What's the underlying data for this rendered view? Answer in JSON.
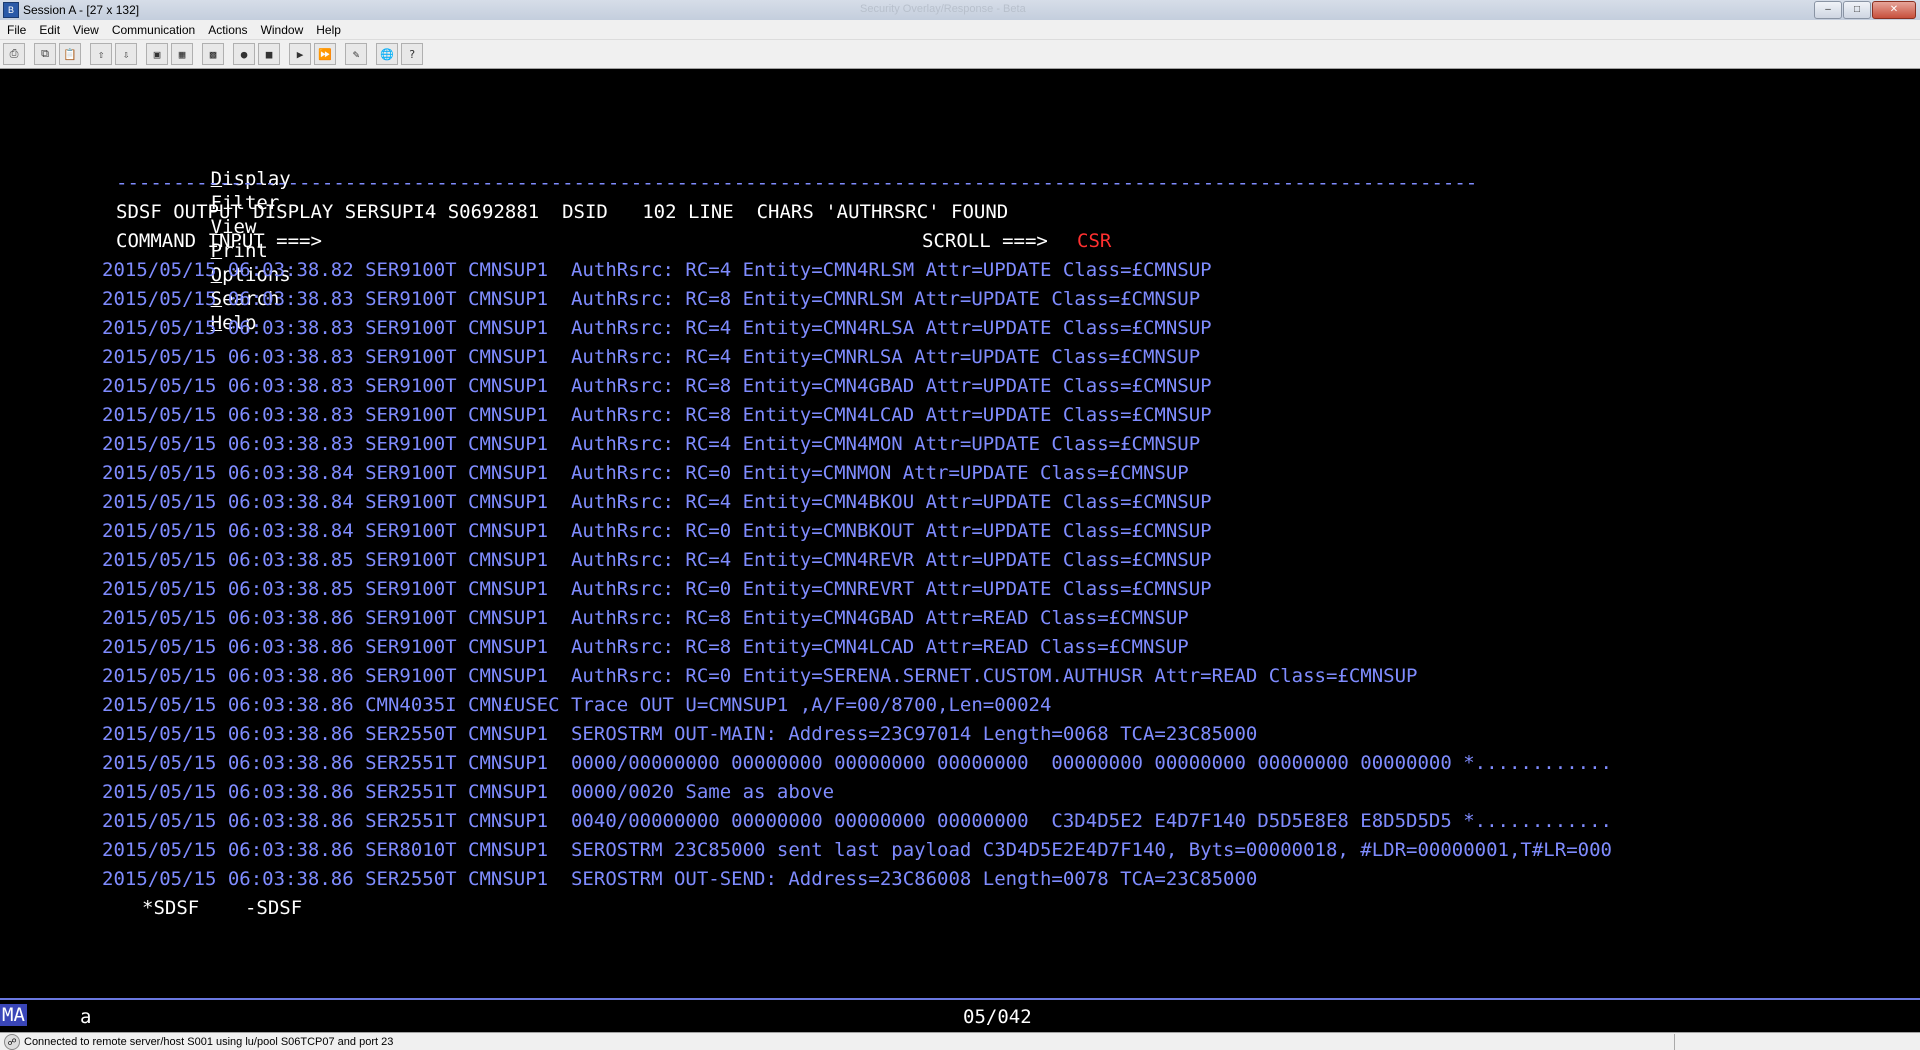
{
  "window": {
    "title": "Session A - [27 x 132]",
    "faded_title": "Security Overlay/Response - Beta",
    "minimize": "–",
    "maximize": "□",
    "close": "✕"
  },
  "menubar": {
    "items": [
      "File",
      "Edit",
      "View",
      "Communication",
      "Actions",
      "Window",
      "Help"
    ]
  },
  "toolbar": {
    "icons": [
      "print-screen-icon",
      "copy-icon",
      "paste-icon",
      "send-file-icon",
      "receive-file-icon",
      "display-icon",
      "keypad-icon",
      "color-map-icon",
      "macro-record-icon",
      "macro-stop-icon",
      "macro-play-icon",
      "macro-play-2-icon",
      "customize-icon",
      "globe-icon",
      "help-icon"
    ]
  },
  "terminal": {
    "action_bar": {
      "items": [
        {
          "acc": "D",
          "rest": "isplay"
        },
        {
          "acc": "F",
          "rest": "ilter"
        },
        {
          "acc": "V",
          "rest": "iew"
        },
        {
          "acc": "P",
          "rest": "rint"
        },
        {
          "acc": "O",
          "rest": "ptions"
        },
        {
          "acc": "S",
          "rest": "earch"
        },
        {
          "acc": "H",
          "rest": "elp"
        }
      ]
    },
    "separator": "-----------------------------------------------------------------------------------------------------------------------",
    "header_line": "SDSF OUTPUT DISPLAY SERSUPI4 S0692881  DSID   102 LINE  CHARS 'AUTHRSRC' FOUND",
    "command_label": "COMMAND INPUT ===>",
    "command_value": "",
    "scroll_label": "SCROLL ===>",
    "scroll_value": "CSR",
    "lines": [
      "2015/05/15 06:03:38.82 SER9100T CMNSUP1  AuthRsrc: RC=4 Entity=CMN4RLSM Attr=UPDATE Class=£CMNSUP",
      "2015/05/15 06:03:38.83 SER9100T CMNSUP1  AuthRsrc: RC=8 Entity=CMNRLSM Attr=UPDATE Class=£CMNSUP",
      "2015/05/15 06:03:38.83 SER9100T CMNSUP1  AuthRsrc: RC=4 Entity=CMN4RLSA Attr=UPDATE Class=£CMNSUP",
      "2015/05/15 06:03:38.83 SER9100T CMNSUP1  AuthRsrc: RC=4 Entity=CMNRLSA Attr=UPDATE Class=£CMNSUP",
      "2015/05/15 06:03:38.83 SER9100T CMNSUP1  AuthRsrc: RC=8 Entity=CMN4GBAD Attr=UPDATE Class=£CMNSUP",
      "2015/05/15 06:03:38.83 SER9100T CMNSUP1  AuthRsrc: RC=8 Entity=CMN4LCAD Attr=UPDATE Class=£CMNSUP",
      "2015/05/15 06:03:38.83 SER9100T CMNSUP1  AuthRsrc: RC=4 Entity=CMN4MON Attr=UPDATE Class=£CMNSUP",
      "2015/05/15 06:03:38.84 SER9100T CMNSUP1  AuthRsrc: RC=0 Entity=CMNMON Attr=UPDATE Class=£CMNSUP",
      "2015/05/15 06:03:38.84 SER9100T CMNSUP1  AuthRsrc: RC=4 Entity=CMN4BKOU Attr=UPDATE Class=£CMNSUP",
      "2015/05/15 06:03:38.84 SER9100T CMNSUP1  AuthRsrc: RC=0 Entity=CMNBKOUT Attr=UPDATE Class=£CMNSUP",
      "2015/05/15 06:03:38.85 SER9100T CMNSUP1  AuthRsrc: RC=4 Entity=CMN4REVR Attr=UPDATE Class=£CMNSUP",
      "2015/05/15 06:03:38.85 SER9100T CMNSUP1  AuthRsrc: RC=0 Entity=CMNREVRT Attr=UPDATE Class=£CMNSUP",
      "2015/05/15 06:03:38.86 SER9100T CMNSUP1  AuthRsrc: RC=8 Entity=CMN4GBAD Attr=READ Class=£CMNSUP",
      "2015/05/15 06:03:38.86 SER9100T CMNSUP1  AuthRsrc: RC=8 Entity=CMN4LCAD Attr=READ Class=£CMNSUP",
      "2015/05/15 06:03:38.86 SER9100T CMNSUP1  AuthRsrc: RC=0 Entity=SERENA.SERNET.CUSTOM.AUTHUSR Attr=READ Class=£CMNSUP",
      "2015/05/15 06:03:38.86 CMN4035I CMN£USEC Trace OUT U=CMNSUP1 ,A/F=00/8700,Len=00024",
      "2015/05/15 06:03:38.86 SER2550T CMNSUP1  SEROSTRM OUT-MAIN: Address=23C97014 Length=0068 TCA=23C85000",
      "2015/05/15 06:03:38.86 SER2551T CMNSUP1  0000/00000000 00000000 00000000 00000000  00000000 00000000 00000000 00000000 *............",
      "2015/05/15 06:03:38.86 SER2551T CMNSUP1  0000/0020 Same as above",
      "2015/05/15 06:03:38.86 SER2551T CMNSUP1  0040/00000000 00000000 00000000 00000000  C3D4D5E2 E4D7F140 D5D5E8E8 E8D5D5D5 *............",
      "2015/05/15 06:03:38.86 SER8010T CMNSUP1  SEROSTRM 23C85000 sent last payload C3D4D5E2E4D7F140, Byts=00000018, #LDR=00000001,T#LR=000",
      "2015/05/15 06:03:38.86 SER2550T CMNSUP1  SEROSTRM OUT-SEND: Address=23C86008 Length=0078 TCA=23C85000"
    ],
    "footer": "*SDSF    -SDSF"
  },
  "oia": {
    "mode": "MA",
    "indicator": "a",
    "cursor_position": "05/042"
  },
  "statusbar": {
    "text": "Connected to remote server/host S001 using lu/pool S06TCP07 and port 23"
  }
}
